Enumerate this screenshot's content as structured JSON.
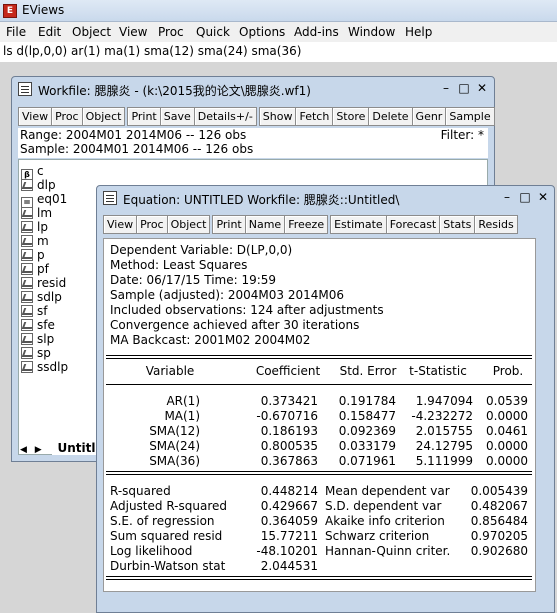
{
  "app": {
    "title": "EViews"
  },
  "menu": [
    "File",
    "Edit",
    "Object",
    "View",
    "Proc",
    "Quick",
    "Options",
    "Add-ins",
    "Window",
    "Help"
  ],
  "command": "ls d(lp,0,0)  ar(1)  ma(1)  sma(12)  sma(24)  sma(36)",
  "workfile": {
    "title": "Workfile: 腮腺炎 - (k:\\2015我的论文\\腮腺炎.wf1)",
    "toolbar": [
      [
        "View",
        "Proc",
        "Object"
      ],
      [
        "Print",
        "Save",
        "Details+/-"
      ],
      [
        "Show",
        "Fetch",
        "Store",
        "Delete",
        "Genr",
        "Sample"
      ]
    ],
    "range": "Range:  2004M01 2014M06   --   126 obs",
    "sample": "Sample: 2004M01 2014M06   --   126 obs",
    "filter": "Filter: *",
    "objects": [
      {
        "name": "c",
        "icon": "beta"
      },
      {
        "name": "dlp",
        "icon": "series"
      },
      {
        "name": "eq01",
        "icon": "equation"
      },
      {
        "name": "lm",
        "icon": "series"
      },
      {
        "name": "lp",
        "icon": "series"
      },
      {
        "name": "m",
        "icon": "series"
      },
      {
        "name": "p",
        "icon": "series"
      },
      {
        "name": "pf",
        "icon": "series"
      },
      {
        "name": "resid",
        "icon": "series"
      },
      {
        "name": "sdlp",
        "icon": "series"
      },
      {
        "name": "sf",
        "icon": "series"
      },
      {
        "name": "sfe",
        "icon": "series"
      },
      {
        "name": "slp",
        "icon": "series"
      },
      {
        "name": "sp",
        "icon": "series"
      },
      {
        "name": "ssdlp",
        "icon": "series"
      }
    ],
    "tab": "Untitled"
  },
  "equation": {
    "title": "Equation: UNTITLED   Workfile: 腮腺炎::Untitled\\",
    "toolbar": [
      [
        "View",
        "Proc",
        "Object"
      ],
      [
        "Print",
        "Name",
        "Freeze"
      ],
      [
        "Estimate",
        "Forecast",
        "Stats",
        "Resids"
      ]
    ],
    "header": [
      "Dependent Variable: D(LP,0,0)",
      "Method: Least Squares",
      "Date: 06/17/15   Time: 19:59",
      "Sample (adjusted): 2004M03 2014M06",
      "Included observations: 124 after adjustments",
      "Convergence achieved after 30 iterations",
      "MA Backcast: 2001M02 2004M02"
    ],
    "columns": [
      "Variable",
      "Coefficient",
      "Std. Error",
      "t-Statistic",
      "Prob."
    ],
    "rows": [
      [
        "AR(1)",
        "0.373421",
        "0.191784",
        "1.947094",
        "0.0539"
      ],
      [
        "MA(1)",
        "-0.670716",
        "0.158477",
        "-4.232272",
        "0.0000"
      ],
      [
        "SMA(12)",
        "0.186193",
        "0.092369",
        "2.015755",
        "0.0461"
      ],
      [
        "SMA(24)",
        "0.800535",
        "0.033179",
        "24.12795",
        "0.0000"
      ],
      [
        "SMA(36)",
        "0.367863",
        "0.071961",
        "5.111999",
        "0.0000"
      ]
    ],
    "stats_left": [
      [
        "R-squared",
        "0.448214"
      ],
      [
        "Adjusted R-squared",
        "0.429667"
      ],
      [
        "S.E. of regression",
        "0.364059"
      ],
      [
        "Sum squared resid",
        "15.77211"
      ],
      [
        "Log likelihood",
        "-48.10201"
      ],
      [
        "Durbin-Watson stat",
        "2.044531"
      ]
    ],
    "stats_right": [
      [
        "Mean dependent var",
        "0.005439"
      ],
      [
        "S.D. dependent var",
        "0.482067"
      ],
      [
        "Akaike info criterion",
        "0.856484"
      ],
      [
        "Schwarz criterion",
        "0.970205"
      ],
      [
        "Hannan-Quinn criter.",
        "0.902680"
      ]
    ]
  }
}
